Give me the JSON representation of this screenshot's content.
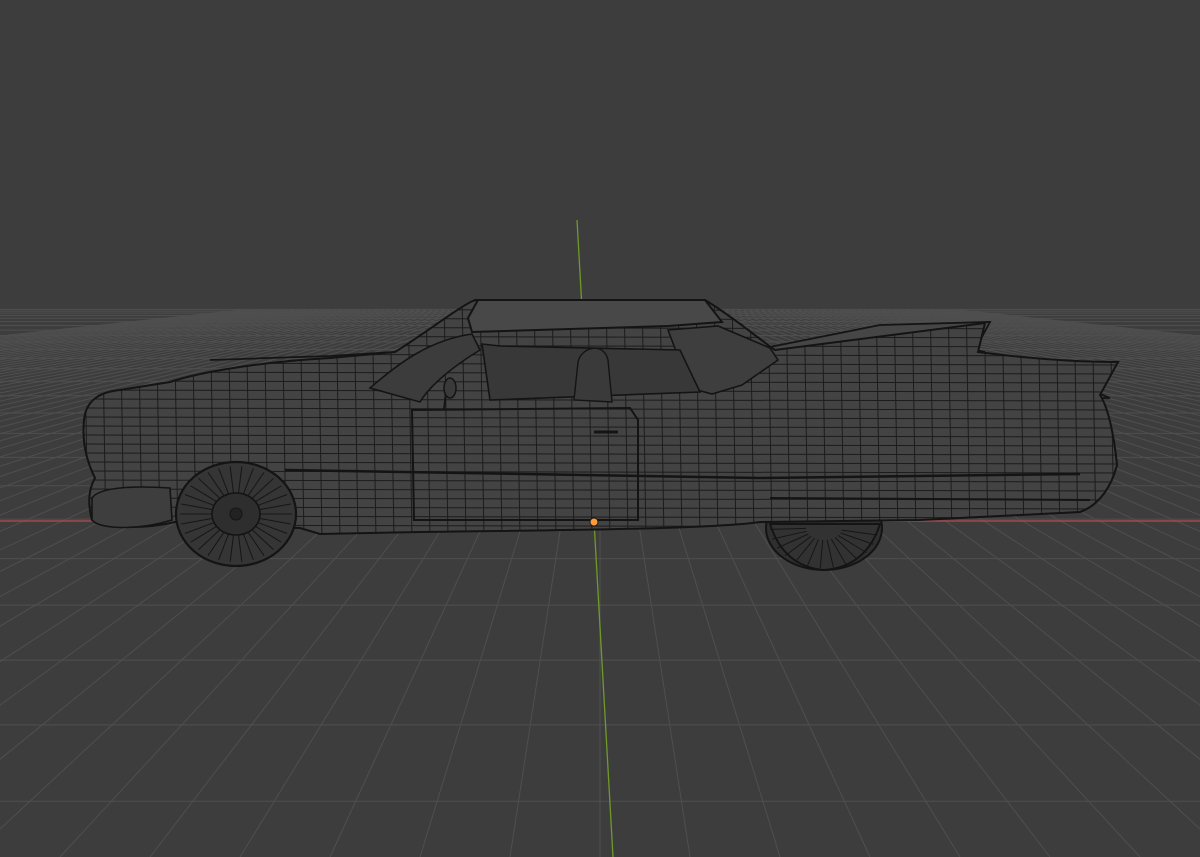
{
  "viewport": {
    "background": "#3d3d3d",
    "grid_color": "#4f4f4f",
    "x_axis_color": "#a14a4d",
    "z_axis_color": "#6f9a2a",
    "wire_color": "#141414",
    "body_fill": "#434343",
    "origin_color": "#ff9a3a",
    "view": "side-orthographic-perspective",
    "shading": "wireframe-overlay"
  },
  "object": {
    "name_icon": "car-mesh-icon",
    "selected": false
  }
}
